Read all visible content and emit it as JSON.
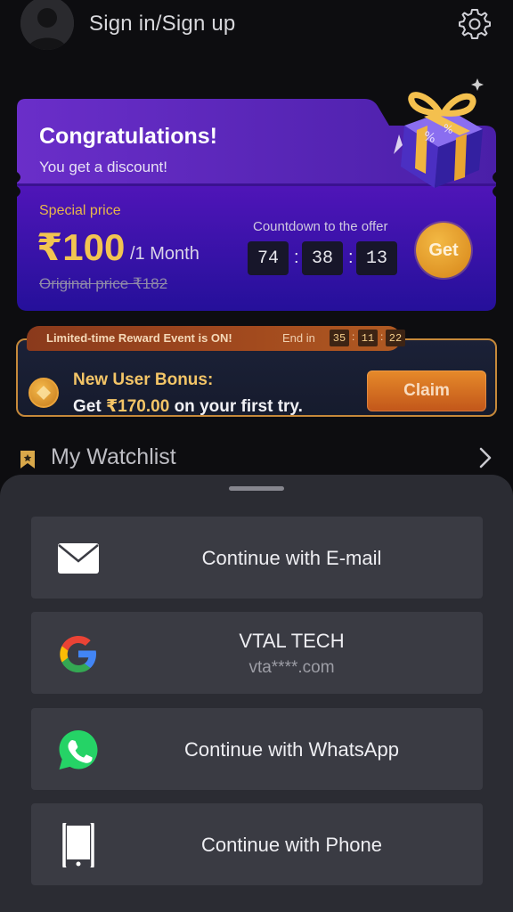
{
  "header": {
    "signin_label": "Sign in/Sign up",
    "avatar_icon": "user-avatar-icon",
    "settings_icon": "gear-icon"
  },
  "offer": {
    "title": "Congratulations!",
    "subtitle": "You get a discount!",
    "special_label": "Special price",
    "price": "₹100",
    "period": "/1 Month",
    "original_price": "Original price ₹182",
    "countdown_label": "Countdown to the offer",
    "countdown": [
      "74",
      "38",
      "13"
    ],
    "get_label": "Get",
    "gift_icon": "gift-box-icon"
  },
  "bonus": {
    "tag_text": "Limited-time Reward Event is ON!",
    "end_label": "End in",
    "end_countdown": [
      "35",
      "11",
      "22"
    ],
    "title": "New User Bonus:",
    "line_prefix": "Get ",
    "amount": "₹170.00",
    "line_suffix": " on your first try.",
    "claim_label": "Claim",
    "coin_icon": "coin-icon"
  },
  "watchlist": {
    "label": "My Watchlist",
    "icon": "bookmark-icon",
    "chevron": "chevron-right-icon"
  },
  "login_sheet": {
    "options": [
      {
        "label": "Continue with E-mail",
        "icon": "mail-icon"
      },
      {
        "label": "VTAL TECH",
        "sublabel": "vta****.com",
        "icon": "google-icon"
      },
      {
        "label": "Continue with WhatsApp",
        "icon": "whatsapp-icon"
      },
      {
        "label": "Continue with Phone",
        "icon": "phone-icon"
      }
    ]
  },
  "colors": {
    "background": "#0d0d10",
    "offer_purple": "#5a1fb8",
    "gold": "#f2c451",
    "orange": "#e68a2a",
    "sheet": "#2b2c33",
    "option": "#3a3b43"
  }
}
